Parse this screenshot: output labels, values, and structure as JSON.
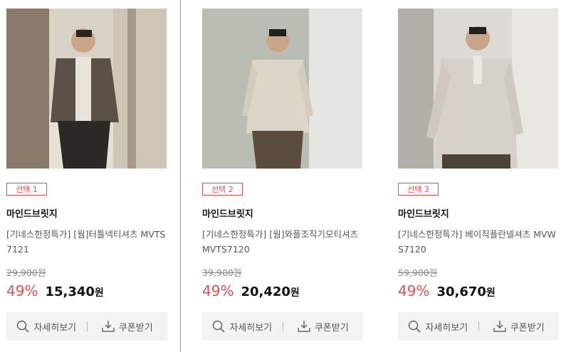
{
  "products": [
    {
      "badge": "선택 1",
      "brand": "마인드브릿지",
      "title": "[기네스한정특가] [웜]터틀넥티셔츠 MVTS7121",
      "original_price": "29,900원",
      "discount": "49%",
      "price": "15,340",
      "currency": "원",
      "detail_label": "자세히보기",
      "coupon_label": "쿠폰받기"
    },
    {
      "badge": "선택 2",
      "brand": "마인드브릿지",
      "title": "[기네스한정특가] [웜]와플조직기모티셔츠 MVTS7120",
      "original_price": "39,900원",
      "discount": "49%",
      "price": "20,420",
      "currency": "원",
      "detail_label": "자세히보기",
      "coupon_label": "쿠폰받기"
    },
    {
      "badge": "선택 3",
      "brand": "마인드브릿지",
      "title": "[기네스한정특가] 베이직플란넬셔츠 MVWS7120",
      "original_price": "59,900원",
      "discount": "49%",
      "price": "30,670",
      "currency": "원",
      "detail_label": "자세히보기",
      "coupon_label": "쿠폰받기"
    }
  ],
  "colors": {
    "accent": "#e54b4b",
    "action_bg": "#f3f3f3",
    "divider": "#9a9a9a"
  },
  "icons": {
    "detail": "search-icon",
    "coupon": "download-icon"
  }
}
